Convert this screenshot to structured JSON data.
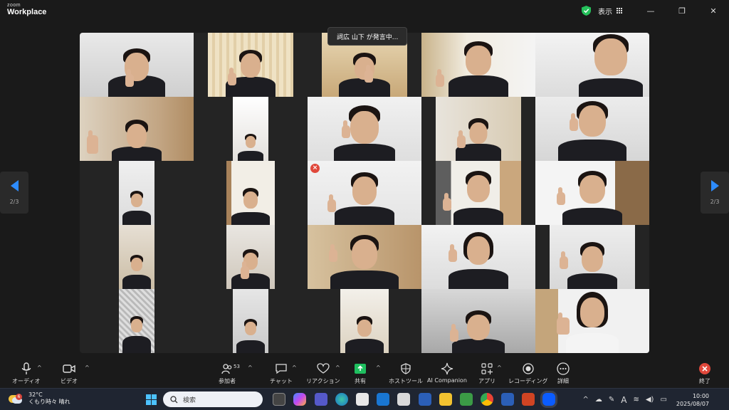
{
  "titlebar": {
    "brand_small": "zoom",
    "brand_main": "Workplace",
    "view_label": "表示",
    "icons": [
      "shield-check-icon",
      "grid-icon",
      "minimize-icon",
      "restore-icon",
      "close-icon"
    ]
  },
  "speaking_banner": "詞広 山下 が発言中...",
  "gallery": {
    "page_indicator_left": "2/3",
    "page_indicator_right": "2/3",
    "participants_visible": 25
  },
  "toolbar": {
    "audio": "オーディオ",
    "video": "ビデオ",
    "participants": "参加者",
    "participants_count": "53",
    "chat": "チャット",
    "reactions": "リアクション",
    "share": "共有",
    "host_tools": "ホストツール",
    "ai_companion": "AI Companion",
    "apps": "アプリ",
    "record": "レコーディング",
    "more": "詳細",
    "end": "終了"
  },
  "taskbar": {
    "temperature": "32°C",
    "weather": "くもり時々 晴れ",
    "weather_badge": "6",
    "search_placeholder": "検索",
    "time": "10:00",
    "date": "2025/08/07",
    "tray_font_indicator": "A"
  },
  "colors": {
    "accent_blue": "#2d8cff",
    "share_green": "#1fbf5f",
    "end_red": "#e0483b",
    "shield_green": "#25c15b"
  }
}
